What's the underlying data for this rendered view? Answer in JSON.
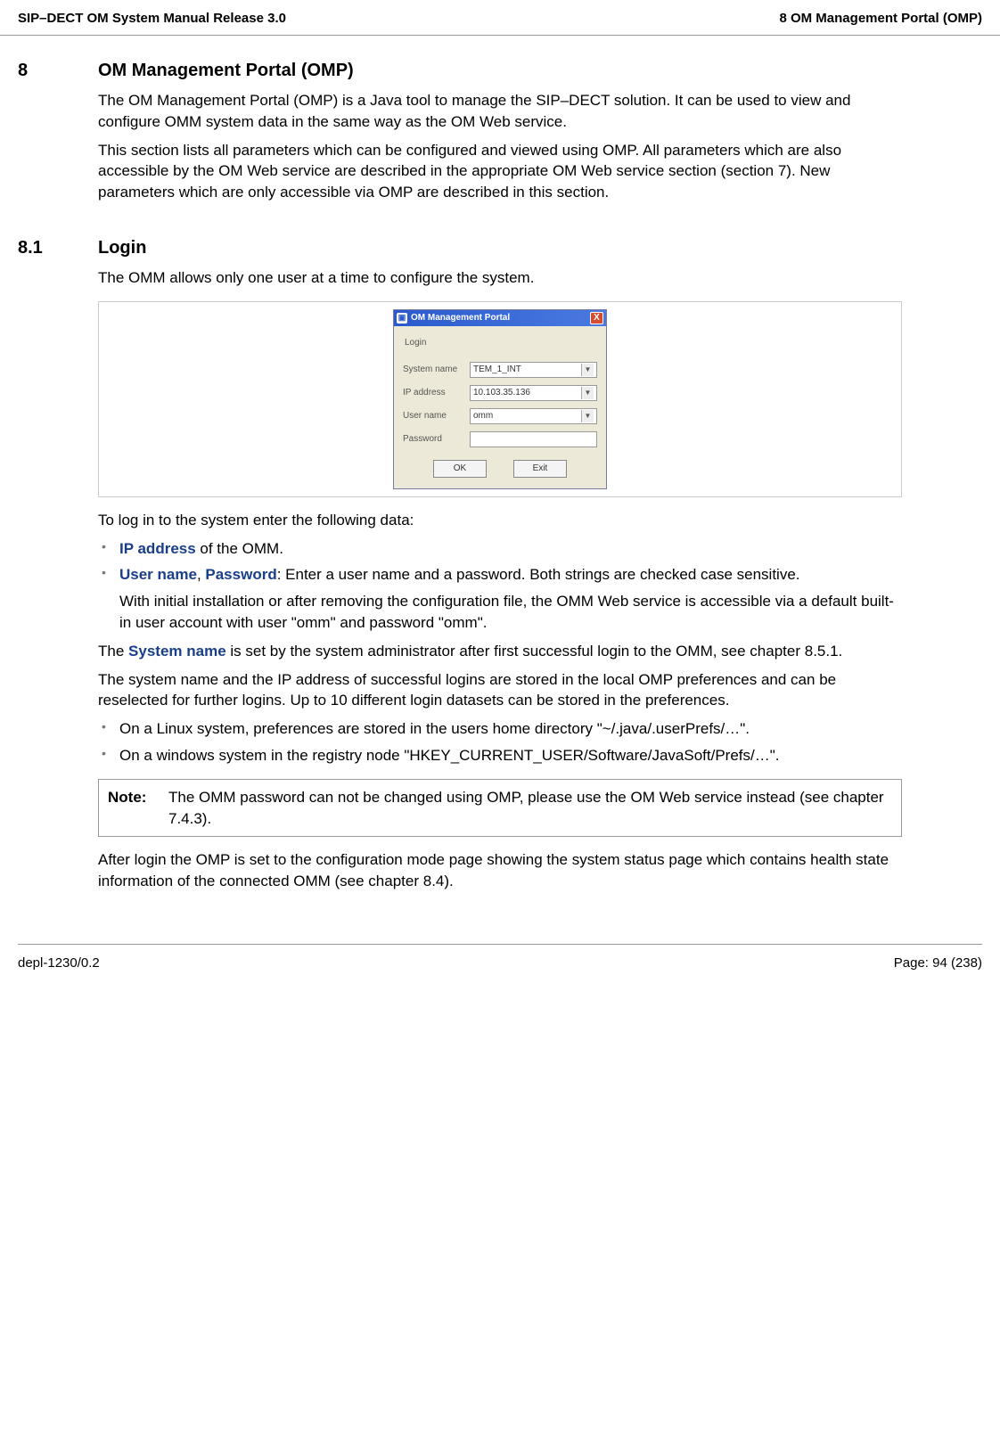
{
  "header": {
    "left": "SIP–DECT OM System Manual Release 3.0",
    "right": "8 OM Management Portal (OMP)"
  },
  "section8": {
    "num": "8",
    "title": "OM Management Portal (OMP)",
    "p1": "The OM Management Portal (OMP) is a Java tool to manage the SIP–DECT solution. It can be used to view and configure OMM system data in the same way as the OM Web service.",
    "p2": "This section lists all parameters which can be configured and viewed using OMP. All parameters which are also accessible by the OM Web service are described in the appropriate OM Web service section (section 7). New parameters which are only accessible via OMP are described in this section."
  },
  "section81": {
    "num": "8.1",
    "title": "Login",
    "p1": "The OMM allows only one user at a time to configure the system."
  },
  "dialog": {
    "title": "OM Management Portal",
    "loginLabel": "Login",
    "rows": {
      "systemName": {
        "label": "System name",
        "value": "TEM_1_INT"
      },
      "ipAddress": {
        "label": "IP address",
        "value": "10.103.35.136"
      },
      "userName": {
        "label": "User name",
        "value": "omm"
      },
      "password": {
        "label": "Password",
        "value": ""
      }
    },
    "buttons": {
      "ok": "OK",
      "exit": "Exit"
    }
  },
  "afterFigure": {
    "intro": "To log in to the system enter the following data:",
    "ipAddressLabel": "IP address",
    "ipAddressRest": " of the OMM.",
    "userNameLabel": "User name",
    "passwordLabel": "Password",
    "userPwdRest": ": Enter a user name and a password. Both strings are checked case sensitive.",
    "userPwdSub": "With initial installation or after removing the configuration file, the OMM Web service is accessible via a default built-in user account with user \"omm\" and password \"omm\".",
    "systemNamePre": "The ",
    "systemNameLabel": "System name",
    "systemNamePost": " is set by the system administrator after first successful login to the OMM, see chapter 8.5.1.",
    "storedPara": "The system name and the IP address of successful logins are stored in the local OMP preferences and can be reselected for further logins. Up to 10 different login datasets can be stored in the preferences.",
    "linuxBullet": "On a Linux system, preferences are stored in the users home directory \"~/.java/.userPrefs/…\".",
    "windowsBullet": "On a windows system in the registry node \"HKEY_CURRENT_USER/Software/JavaSoft/Prefs/…\".",
    "noteLabel": "Note:",
    "noteText": "The OMM password can not be changed using OMP, please use the OM Web service instead (see chapter 7.4.3).",
    "afterLogin": "After login the OMP is set to the configuration mode page showing the system status page which contains health state information of the connected OMM (see chapter 8.4)."
  },
  "footer": {
    "left": "depl-1230/0.2",
    "right": "Page: 94 (238)"
  }
}
